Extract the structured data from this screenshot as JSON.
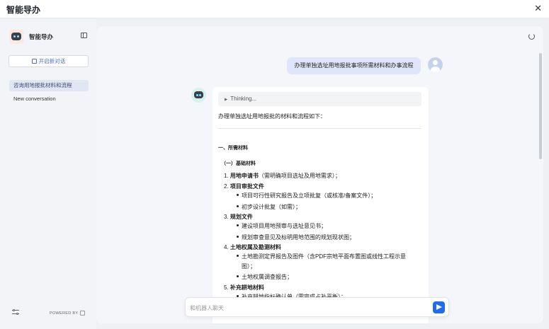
{
  "window": {
    "title": "智能导办",
    "close_icon": "close-icon"
  },
  "sidebar": {
    "brand": "智能导办",
    "new_chat_label": "开启新对话",
    "conversations": [
      {
        "label": "咨询用地报批材料和流程",
        "active": true
      },
      {
        "label": "New conversation",
        "active": false
      }
    ],
    "powered_by": "POWERED BY"
  },
  "chat": {
    "user_message": "办理单独选址用地报批事项所需材料和办事流程",
    "thinking_label": "Thinking...",
    "intro": "办理单独选址用地报批的材料和流程如下：",
    "section_title": "一、所需材料",
    "subsection_title": "（一）基础材料",
    "items": [
      {
        "num": "1.",
        "title": "用地申请书",
        "note": "（需明确项目选址及用地需求）；"
      },
      {
        "num": "2.",
        "title": "项目审批文件",
        "bullets": [
          "项目可行性研究报告及立项批复（或核准/备案文件）；",
          "初步设计批复（如需）；"
        ]
      },
      {
        "num": "3.",
        "title": "规划文件",
        "bullets": [
          "建设项目用地预审与选址意见书；",
          "规划审查意见及标明用地范围的规划现状图；"
        ]
      },
      {
        "num": "4.",
        "title": "土地权属及勘测材料",
        "bullets": [
          "土地勘测定界报告及图件（含PDF宗地平面布置图或线性工程示意",
          "图）；",
          "土地权属调查报告；"
        ]
      },
      {
        "num": "5.",
        "title": "补充耕地材料",
        "bullets": [
          "补充耕地指标确认单（需完成占补平衡）；"
        ]
      }
    ]
  },
  "input": {
    "placeholder": "和机器人聊天"
  },
  "colors": {
    "accent": "#1f6cf0",
    "user_bubble": "#dfe6fb",
    "active_conv": "#e1e6f4"
  }
}
